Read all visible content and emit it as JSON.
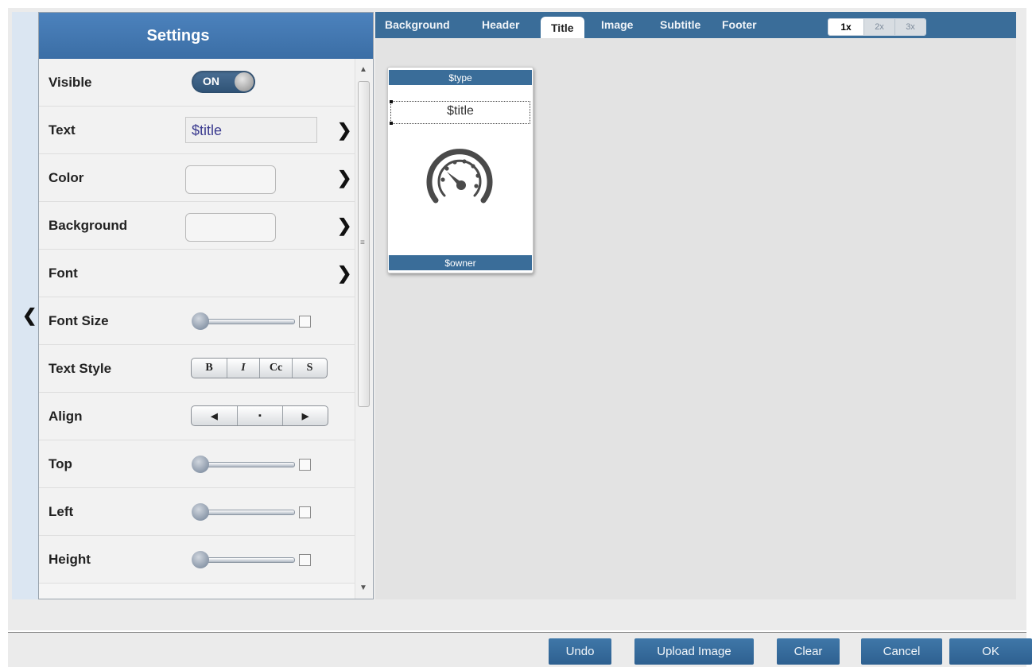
{
  "settings": {
    "title": "Settings",
    "rows": [
      {
        "label": "Visible",
        "toggle": "ON"
      },
      {
        "label": "Text",
        "value": "$title"
      },
      {
        "label": "Color"
      },
      {
        "label": "Background"
      },
      {
        "label": "Font"
      },
      {
        "label": "Font Size"
      },
      {
        "label": "Text Style",
        "buttons": [
          "B",
          "I",
          "Cc",
          "S"
        ]
      },
      {
        "label": "Align",
        "buttons": [
          "◀",
          "▪",
          "▶"
        ]
      },
      {
        "label": "Top"
      },
      {
        "label": "Left"
      },
      {
        "label": "Height"
      }
    ]
  },
  "tabs": [
    {
      "label": "Background"
    },
    {
      "label": "Header"
    },
    {
      "label": "Title",
      "active": true
    },
    {
      "label": "Image"
    },
    {
      "label": "Subtitle"
    },
    {
      "label": "Footer"
    }
  ],
  "zoom": [
    "1x",
    "2x",
    "3x"
  ],
  "zoom_selected": "1x",
  "preview": {
    "header": "$type",
    "title": "$title",
    "icon": "speedometer-icon",
    "footer": "$owner"
  },
  "buttons": {
    "undo": "Undo",
    "upload": "Upload Image",
    "clear": "Clear",
    "cancel": "Cancel",
    "ok": "OK"
  },
  "colors": {
    "accent": "#3a6d99",
    "header": "#3b6ea5"
  }
}
